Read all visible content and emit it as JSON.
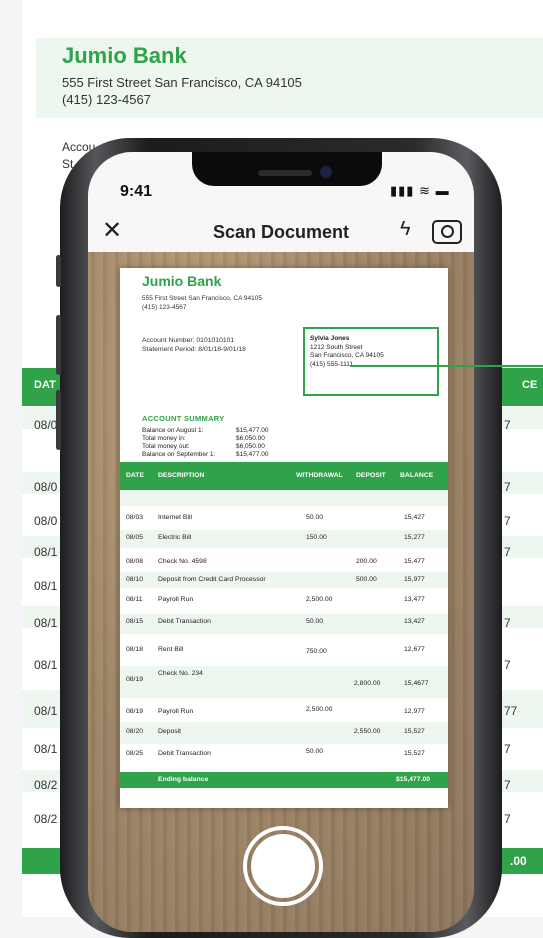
{
  "background_statement": {
    "bank_name": "Jumio Bank",
    "address_line1": "555 First Street   San Francisco, CA 94105",
    "address_line2": "(415) 123-4567",
    "account_partial": "Accou",
    "statement_partial": "St",
    "date_header": "DAT",
    "balance_header": "CE",
    "left_dates": [
      "08/0",
      "08/0",
      "08/0",
      "08/1",
      "08/1",
      "08/1",
      "08/1",
      "08/1",
      "08/1",
      "08/2",
      "08/2"
    ],
    "right_values": [
      "7",
      "7",
      "7",
      "7",
      "7",
      "7",
      "7",
      "77",
      "7",
      "7",
      "7"
    ],
    "footer_value": ".00"
  },
  "phone": {
    "status_time": "9:41",
    "screen_title": "Scan Document",
    "close_icon": "close-icon",
    "flash_icon": "lightning-bolt-icon",
    "camera_flip_icon": "camera-rotate-icon"
  },
  "scanned_document": {
    "bank_name": "Jumio Bank",
    "address_line1": "555 First Street   San Francisco, CA 94105",
    "address_line2": "(415) 123-4567",
    "account_number": "Account Number: 0101010101",
    "statement_period": "Statement Period: 8/01/18-9/01/18",
    "customer": {
      "name": "Sylvia Jones",
      "street": "1212 South Street",
      "city": "San Francisco, CA 94105",
      "phone": "(415) 555-1111"
    },
    "summary_title": "ACCOUNT SUMMARY",
    "summary": [
      {
        "label": "Balance on August 1:",
        "value": "$15,477.00"
      },
      {
        "label": "Total money in:",
        "value": "$6,050.00"
      },
      {
        "label": "Total money out:",
        "value": "$6,050.00"
      },
      {
        "label": "Balance on September 1:",
        "value": "$15,477.00"
      }
    ],
    "columns": [
      "DATE",
      "DESCRIPTION",
      "WITHDRAWAL",
      "DEPOSIT",
      "BALANCE"
    ],
    "transactions": [
      {
        "date": "08/03",
        "desc": "Internet Bill",
        "withdrawal": "50.00",
        "deposit": "",
        "balance": "15,427"
      },
      {
        "date": "08/05",
        "desc": "Electric Bill",
        "withdrawal": "150.00",
        "deposit": "",
        "balance": "15,277"
      },
      {
        "date": "08/08",
        "desc": "Check No. 4598",
        "withdrawal": "",
        "deposit": "200.00",
        "balance": "15,477"
      },
      {
        "date": "08/10",
        "desc": "Deposit from Credit Card Processor",
        "withdrawal": "",
        "deposit": "500.00",
        "balance": "15,977"
      },
      {
        "date": "08/11",
        "desc": "Payroll Run",
        "withdrawal": "2,500.00",
        "deposit": "",
        "balance": "13,477"
      },
      {
        "date": "08/15",
        "desc": "Debit Transaction",
        "withdrawal": "50.00",
        "deposit": "",
        "balance": "13,427"
      },
      {
        "date": "08/18",
        "desc": "Rent Bill",
        "withdrawal": "750.00",
        "deposit": "",
        "balance": "12,677"
      },
      {
        "date": "08/19",
        "desc": "Check No. 234",
        "withdrawal": "",
        "deposit": "2,800.00",
        "balance": "15,4677"
      },
      {
        "date": "08/19",
        "desc": "Payroll Run",
        "withdrawal": "2,500.00",
        "deposit": "",
        "balance": "12,977"
      },
      {
        "date": "08/20",
        "desc": "Deposit",
        "withdrawal": "",
        "deposit": "2,550.00",
        "balance": "15,527"
      },
      {
        "date": "08/25",
        "desc": "Debit Transaction",
        "withdrawal": "50.00",
        "deposit": "",
        "balance": "15,527"
      }
    ],
    "ending_label": "Ending balance",
    "ending_value": "$15,477.00"
  },
  "colors": {
    "brand_green": "#2fa24a",
    "row_tint": "#eef7ef"
  }
}
